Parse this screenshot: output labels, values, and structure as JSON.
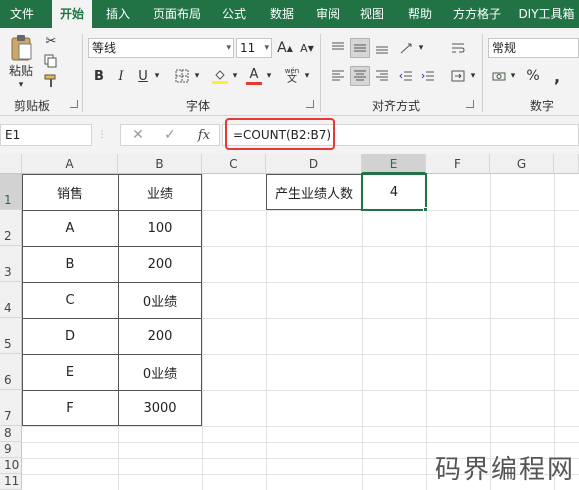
{
  "menu": {
    "items": [
      "文件",
      "开始",
      "插入",
      "页面布局",
      "公式",
      "数据",
      "审阅",
      "视图",
      "帮助",
      "方方格子",
      "DIY工具箱"
    ],
    "active_index": 1
  },
  "ribbon": {
    "clipboard": {
      "paste_label": "粘贴",
      "group_label": "剪贴板"
    },
    "font": {
      "name": "等线",
      "size": "11",
      "bold": "B",
      "italic": "I",
      "underline": "U",
      "group_label": "字体",
      "grow": "A",
      "shrink": "A",
      "phonetic": "wén",
      "font_color_glyph": "A"
    },
    "alignment": {
      "group_label": "对齐方式"
    },
    "number": {
      "format": "常规",
      "group_label": "数字",
      "percent": "%",
      "comma": ","
    }
  },
  "formula_bar": {
    "name_box": "E1",
    "fx_label": "fx",
    "formula": "=COUNT(B2:B7)"
  },
  "sheet": {
    "columns": [
      "A",
      "B",
      "C",
      "D",
      "E",
      "F",
      "G"
    ],
    "selected_column": "E",
    "rows": [
      "1",
      "2",
      "3",
      "4",
      "5",
      "6",
      "7",
      "8",
      "9",
      "10",
      "11"
    ],
    "selected_row": "1",
    "table": {
      "headers": [
        "销售",
        "业绩"
      ],
      "rows": [
        [
          "A",
          "100"
        ],
        [
          "B",
          "200"
        ],
        [
          "C",
          "0业绩"
        ],
        [
          "D",
          "200"
        ],
        [
          "E",
          "0业绩"
        ],
        [
          "F",
          "3000"
        ]
      ]
    },
    "summary": {
      "label": "产生业绩人数",
      "value": "4"
    }
  },
  "watermark": "码界编程网",
  "colors": {
    "accent": "#217346",
    "highlight": "#e53935"
  }
}
